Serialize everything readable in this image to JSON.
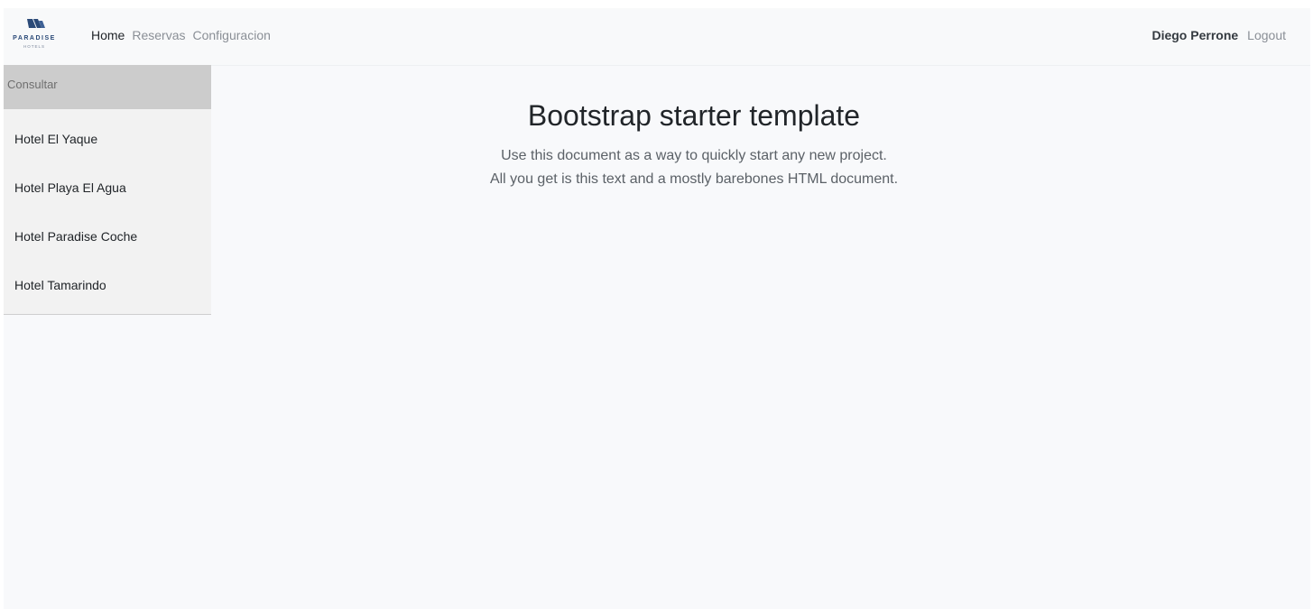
{
  "navbar": {
    "logo": {
      "icon": "sails-icon",
      "word": "PARADISE",
      "sub": "HOTELS"
    },
    "links": [
      {
        "label": "Home",
        "active": true
      },
      {
        "label": "Reservas",
        "active": false
      },
      {
        "label": "Configuracion",
        "active": false
      }
    ],
    "user": "Diego Perrone",
    "logout": "Logout"
  },
  "sidebar": {
    "header": "Consultar",
    "items": [
      {
        "label": "Hotel El Yaque"
      },
      {
        "label": "Hotel Playa El Agua"
      },
      {
        "label": "Hotel Paradise Coche"
      },
      {
        "label": "Hotel Tamarindo"
      }
    ]
  },
  "main": {
    "title": "Bootstrap starter template",
    "lines": [
      "Use this document as a way to quickly start any new project.",
      "All you get is this text and a mostly barebones HTML document."
    ]
  },
  "colors": {
    "background": "#f8f9fb",
    "sidebar": "#f2f2f2",
    "sidebar_header": "#cccccc",
    "logo": "#2b4a78"
  }
}
